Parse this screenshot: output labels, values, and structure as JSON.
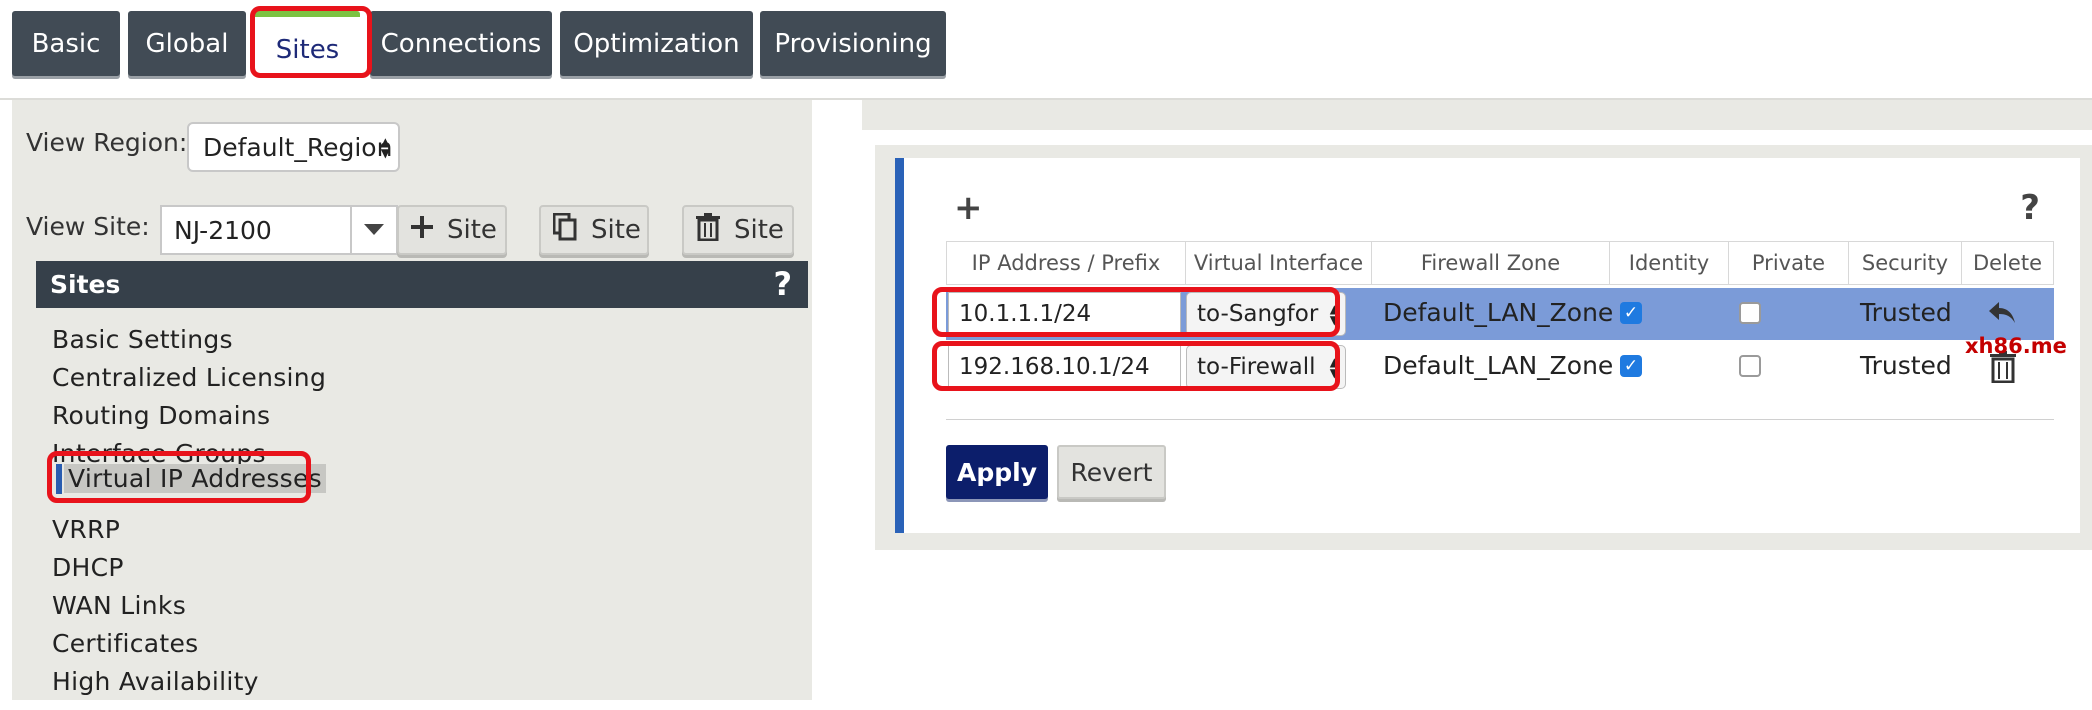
{
  "tabs": [
    {
      "label": "Basic"
    },
    {
      "label": "Global"
    },
    {
      "label": "Sites",
      "active": true
    },
    {
      "label": "Connections"
    },
    {
      "label": "Optimization"
    },
    {
      "label": "Provisioning"
    }
  ],
  "left": {
    "view_region_label": "View Region:",
    "view_region_value": "Default_Region",
    "view_site_label": "View Site:",
    "view_site_value": "NJ-2100",
    "site_buttons": [
      {
        "label": "Site",
        "icon": "plus-icon"
      },
      {
        "label": "Site",
        "icon": "copy-icon"
      },
      {
        "label": "Site",
        "icon": "trash-icon"
      }
    ],
    "sites_header": "Sites",
    "sites_help": "?",
    "menu": [
      {
        "label": "Basic Settings"
      },
      {
        "label": "Centralized Licensing"
      },
      {
        "label": "Routing Domains"
      },
      {
        "label": "Interface Groups"
      },
      {
        "label": "Virtual IP Addresses",
        "active": true
      },
      {
        "label": "VRRP"
      },
      {
        "label": "DHCP"
      },
      {
        "label": "WAN Links"
      },
      {
        "label": "Certificates"
      },
      {
        "label": "High Availability"
      }
    ]
  },
  "vip": {
    "add_symbol": "+",
    "help_symbol": "?",
    "columns": [
      "IP Address / Prefix",
      "Virtual Interface",
      "Firewall Zone",
      "Identity",
      "Private",
      "Security",
      "Delete"
    ],
    "rows": [
      {
        "ip": "10.1.1.1/24",
        "vif": "to-Sangfor",
        "zone": "Default_LAN_Zone",
        "identity": true,
        "private": false,
        "security": "Trusted",
        "action_icon": "undo-icon",
        "selected": true
      },
      {
        "ip": "192.168.10.1/24",
        "vif": "to-Firewall",
        "zone": "Default_LAN_Zone",
        "identity": true,
        "private": false,
        "security": "Trusted",
        "action_icon": "trash-icon",
        "selected": false
      }
    ],
    "apply_label": "Apply",
    "revert_label": "Revert"
  },
  "watermark": "xh86.me",
  "colors": {
    "tab_bg": "#414b55",
    "active_tab_accent": "#7cc242",
    "highlight_red": "#e8131b",
    "selected_row": "#7b9bd8",
    "apply_bg": "#0c1e6b",
    "card_accent": "#2a62b8"
  }
}
